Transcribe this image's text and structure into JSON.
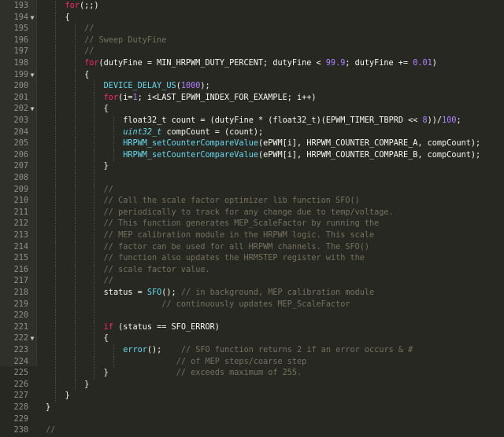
{
  "editor": {
    "colors": {
      "background": "#272822",
      "keyword": "#f92672",
      "function": "#66d9ef",
      "number": "#ae81ff",
      "comment": "#75715e",
      "text": "#f8f8f2"
    },
    "fold_icon": "chevron-down-icon",
    "lines": [
      {
        "n": "193",
        "i": 4,
        "fold": false,
        "tokens": [
          [
            "kw",
            "for"
          ],
          [
            "tx",
            "(;;)"
          ]
        ]
      },
      {
        "n": "194",
        "i": 4,
        "fold": true,
        "tokens": [
          [
            "tx",
            "{"
          ]
        ]
      },
      {
        "n": "195",
        "i": 8,
        "fold": false,
        "tokens": [
          [
            "cm",
            "//"
          ]
        ]
      },
      {
        "n": "196",
        "i": 8,
        "fold": false,
        "tokens": [
          [
            "cm",
            "// Sweep DutyFine"
          ]
        ]
      },
      {
        "n": "197",
        "i": 8,
        "fold": false,
        "tokens": [
          [
            "cm",
            "//"
          ]
        ]
      },
      {
        "n": "198",
        "i": 8,
        "fold": false,
        "tokens": [
          [
            "kw",
            "for"
          ],
          [
            "tx",
            "(dutyFine = MIN_HRPWM_DUTY_PERCENT; dutyFine < "
          ],
          [
            "num",
            "99.9"
          ],
          [
            "tx",
            "; dutyFine += "
          ],
          [
            "num",
            "0.01"
          ],
          [
            "tx",
            ")"
          ]
        ]
      },
      {
        "n": "199",
        "i": 8,
        "fold": true,
        "tokens": [
          [
            "tx",
            "{"
          ]
        ]
      },
      {
        "n": "200",
        "i": 12,
        "fold": false,
        "tokens": [
          [
            "fn",
            "DEVICE_DELAY_US"
          ],
          [
            "tx",
            "("
          ],
          [
            "num",
            "1000"
          ],
          [
            "tx",
            ");"
          ]
        ]
      },
      {
        "n": "201",
        "i": 12,
        "fold": false,
        "tokens": [
          [
            "kw",
            "for"
          ],
          [
            "tx",
            "(i="
          ],
          [
            "num",
            "1"
          ],
          [
            "tx",
            "; i<LAST_EPWM_INDEX_FOR_EXAMPLE; i++)"
          ]
        ]
      },
      {
        "n": "202",
        "i": 12,
        "fold": true,
        "tokens": [
          [
            "tx",
            "{"
          ]
        ]
      },
      {
        "n": "203",
        "i": 16,
        "fold": false,
        "tokens": [
          [
            "tx",
            "float32_t count = (dutyFine * (float32_t)(EPWM_TIMER_TBPRD << "
          ],
          [
            "num",
            "8"
          ],
          [
            "tx",
            "))/"
          ],
          [
            "num",
            "100"
          ],
          [
            "tx",
            ";"
          ]
        ]
      },
      {
        "n": "204",
        "i": 16,
        "fold": false,
        "tokens": [
          [
            "ty",
            "uint32_t"
          ],
          [
            "tx",
            " compCount = (count);"
          ]
        ]
      },
      {
        "n": "205",
        "i": 16,
        "fold": false,
        "tokens": [
          [
            "fn",
            "HRPWM_setCounterCompareValue"
          ],
          [
            "tx",
            "(ePWM[i], HRPWM_COUNTER_COMPARE_A, compCount);"
          ]
        ]
      },
      {
        "n": "206",
        "i": 16,
        "fold": false,
        "tokens": [
          [
            "fn",
            "HRPWM_setCounterCompareValue"
          ],
          [
            "tx",
            "(ePWM[i], HRPWM_COUNTER_COMPARE_B, compCount);"
          ]
        ]
      },
      {
        "n": "207",
        "i": 12,
        "fold": false,
        "tokens": [
          [
            "tx",
            "}"
          ]
        ]
      },
      {
        "n": "208",
        "i": 12,
        "fold": false,
        "tokens": []
      },
      {
        "n": "209",
        "i": 12,
        "fold": false,
        "tokens": [
          [
            "cm",
            "//"
          ]
        ]
      },
      {
        "n": "210",
        "i": 12,
        "fold": false,
        "tokens": [
          [
            "cm",
            "// Call the scale factor optimizer lib function SFO()"
          ]
        ]
      },
      {
        "n": "211",
        "i": 12,
        "fold": false,
        "tokens": [
          [
            "cm",
            "// periodically to track for any change due to temp/voltage."
          ]
        ]
      },
      {
        "n": "212",
        "i": 12,
        "fold": false,
        "tokens": [
          [
            "cm",
            "// This function generates MEP_ScaleFactor by running the"
          ]
        ]
      },
      {
        "n": "213",
        "i": 12,
        "fold": false,
        "tokens": [
          [
            "cm",
            "// MEP calibration module in the HRPWM logic. This scale"
          ]
        ]
      },
      {
        "n": "214",
        "i": 12,
        "fold": false,
        "tokens": [
          [
            "cm",
            "// factor can be used for all HRPWM channels. The SFO()"
          ]
        ]
      },
      {
        "n": "215",
        "i": 12,
        "fold": false,
        "tokens": [
          [
            "cm",
            "// function also updates the HRMSTEP register with the"
          ]
        ]
      },
      {
        "n": "216",
        "i": 12,
        "fold": false,
        "tokens": [
          [
            "cm",
            "// scale factor value."
          ]
        ]
      },
      {
        "n": "217",
        "i": 12,
        "fold": false,
        "tokens": [
          [
            "cm",
            "//"
          ]
        ]
      },
      {
        "n": "218",
        "i": 12,
        "fold": false,
        "tokens": [
          [
            "tx",
            "status = "
          ],
          [
            "fn",
            "SFO"
          ],
          [
            "tx",
            "(); "
          ],
          [
            "cm",
            "// in background, MEP calibration module"
          ]
        ]
      },
      {
        "n": "219",
        "i": 12,
        "fold": false,
        "tokens": [
          [
            "tx",
            "            "
          ],
          [
            "cm",
            "// continuously updates MEP_ScaleFactor"
          ]
        ]
      },
      {
        "n": "220",
        "i": 12,
        "fold": false,
        "tokens": []
      },
      {
        "n": "221",
        "i": 12,
        "fold": false,
        "tokens": [
          [
            "kw",
            "if"
          ],
          [
            "tx",
            " (status == SFO_ERROR)"
          ]
        ]
      },
      {
        "n": "222",
        "i": 12,
        "fold": true,
        "tokens": [
          [
            "tx",
            "{"
          ]
        ]
      },
      {
        "n": "223",
        "i": 16,
        "fold": false,
        "tokens": [
          [
            "fn",
            "error"
          ],
          [
            "tx",
            "();    "
          ],
          [
            "cm",
            "// SFO function returns 2 if an error occurs & #"
          ]
        ]
      },
      {
        "n": "224",
        "i": 16,
        "fold": false,
        "tokens": [
          [
            "tx",
            "           "
          ],
          [
            "cm",
            "// of MEP steps/coarse step"
          ]
        ]
      },
      {
        "n": "225",
        "i": 12,
        "fold": false,
        "tokens": [
          [
            "tx",
            "}              "
          ],
          [
            "cm",
            "// exceeds maximum of 255."
          ]
        ]
      },
      {
        "n": "226",
        "i": 8,
        "fold": false,
        "tokens": [
          [
            "tx",
            "}"
          ]
        ]
      },
      {
        "n": "227",
        "i": 4,
        "fold": false,
        "tokens": [
          [
            "tx",
            "}"
          ]
        ]
      },
      {
        "n": "228",
        "i": 0,
        "fold": false,
        "tokens": [
          [
            "tx",
            "}"
          ]
        ]
      },
      {
        "n": "229",
        "i": 0,
        "fold": false,
        "tokens": []
      },
      {
        "n": "230",
        "i": 0,
        "fold": false,
        "tokens": [
          [
            "cm",
            "//"
          ]
        ]
      }
    ]
  }
}
